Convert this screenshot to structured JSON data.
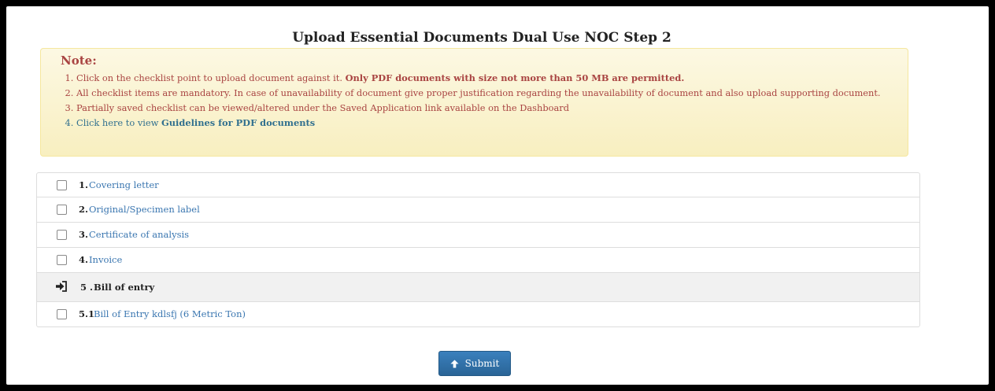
{
  "page": {
    "title": "Upload Essential Documents Dual Use NOC Step 2"
  },
  "note": {
    "title": "Note:",
    "items": [
      {
        "text": "Click on the checklist point to upload document against it. ",
        "bold": "Only PDF documents with size not more than 50 MB are permitted."
      },
      {
        "text": "All checklist items are mandatory. In case of unavailability of document give proper justification regarding the unavailability of document and also upload supporting document."
      },
      {
        "text": "Partially saved checklist can be viewed/altered under the Saved Application link available on the Dashboard"
      },
      {
        "text": "Click here to view ",
        "link": "Guidelines for PDF documents"
      }
    ]
  },
  "checklist": [
    {
      "num": "1.",
      "label": "Covering letter"
    },
    {
      "num": "2.",
      "label": "Original/Specimen label"
    },
    {
      "num": "3.",
      "label": "Certificate of analysis"
    },
    {
      "num": "4.",
      "label": "Invoice"
    },
    {
      "num": "5 .",
      "label": "Bill of entry",
      "header": true,
      "icon": "sign-in-arrow-icon"
    },
    {
      "num": "5.1",
      "label": "Bill of Entry kdlsfj (6 Metric Ton)"
    }
  ],
  "actions": {
    "submit_label": "Submit",
    "submit_icon": "arrow-up-icon"
  },
  "colors": {
    "note_text": "#a94442",
    "note_link": "#31708f",
    "link": "#3a76b0",
    "button": "#2f70a8"
  }
}
